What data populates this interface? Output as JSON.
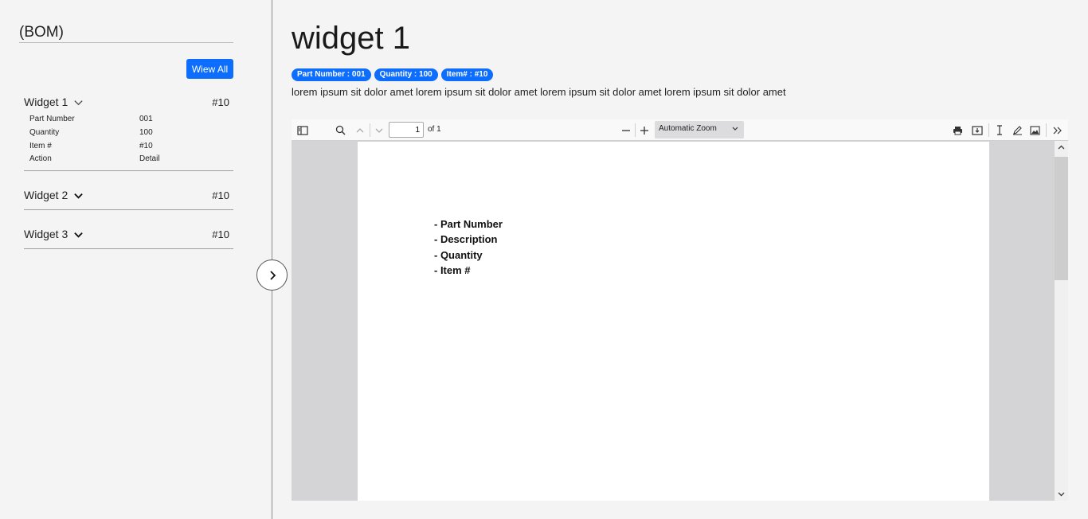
{
  "sidebar": {
    "title": "(BOM)",
    "view_all_label": "Wiew All",
    "widgets": [
      {
        "title": "Widget 1",
        "num": "#10",
        "expanded": true,
        "details": [
          {
            "label": "Part Number",
            "value": "001"
          },
          {
            "label": "Quantity",
            "value": "100"
          },
          {
            "label": "Item #",
            "value": "#10"
          },
          {
            "label": "Action",
            "value": "Detail"
          }
        ]
      },
      {
        "title": "Widget 2",
        "num": "#10",
        "expanded": false
      },
      {
        "title": "Widget 3",
        "num": "#10",
        "expanded": false
      }
    ]
  },
  "main": {
    "title": "widget 1",
    "badges": [
      "Part Number : 001",
      "Quantity : 100",
      "Item# : #10"
    ],
    "description": "lorem ipsum sit dolor amet lorem ipsum sit dolor amet lorem ipsum sit dolor amet lorem ipsum sit dolor amet"
  },
  "pdf": {
    "page_value": "1",
    "page_of": "of 1",
    "zoom": "Automatic Zoom",
    "lines": [
      "- Part Number",
      "- Description",
      "- Quantity",
      "- Item #"
    ]
  },
  "colors": {
    "accent": "#0d6efd",
    "background": "#f4f4f4"
  }
}
